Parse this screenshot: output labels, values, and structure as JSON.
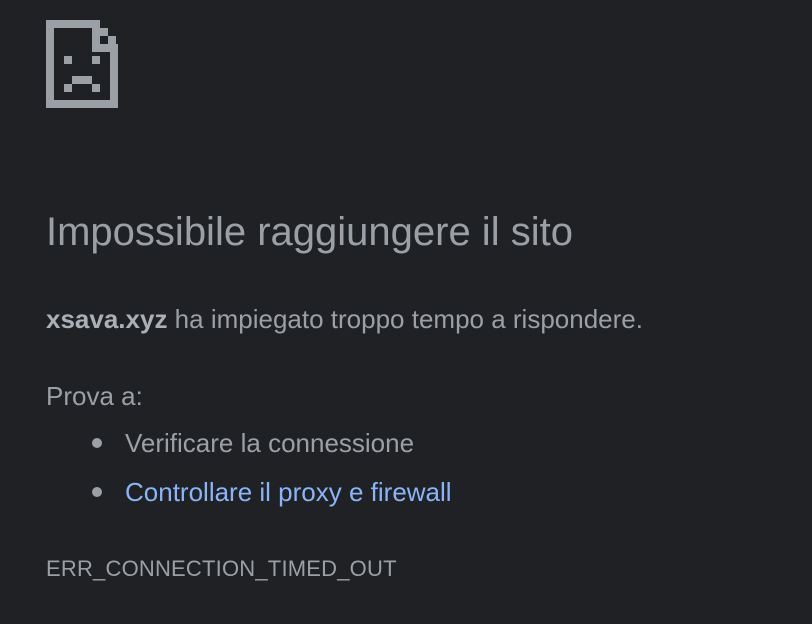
{
  "icon": {
    "name": "sad-page-icon",
    "color": "#9aa0a6"
  },
  "error_page": {
    "title": "Impossibile raggiungere il sito",
    "host": "xsava.xyz",
    "summary_suffix": " ha impiegato troppo tempo a rispondere.",
    "try_label": "Prova a:",
    "suggestions": [
      {
        "label": "Verificare la connessione",
        "is_link": false
      },
      {
        "label": "Controllare il proxy e firewall",
        "is_link": true
      }
    ],
    "error_code": "ERR_CONNECTION_TIMED_OUT"
  },
  "colors": {
    "background": "#202124",
    "text": "#9aa0a6",
    "link": "#8ab4f8"
  }
}
